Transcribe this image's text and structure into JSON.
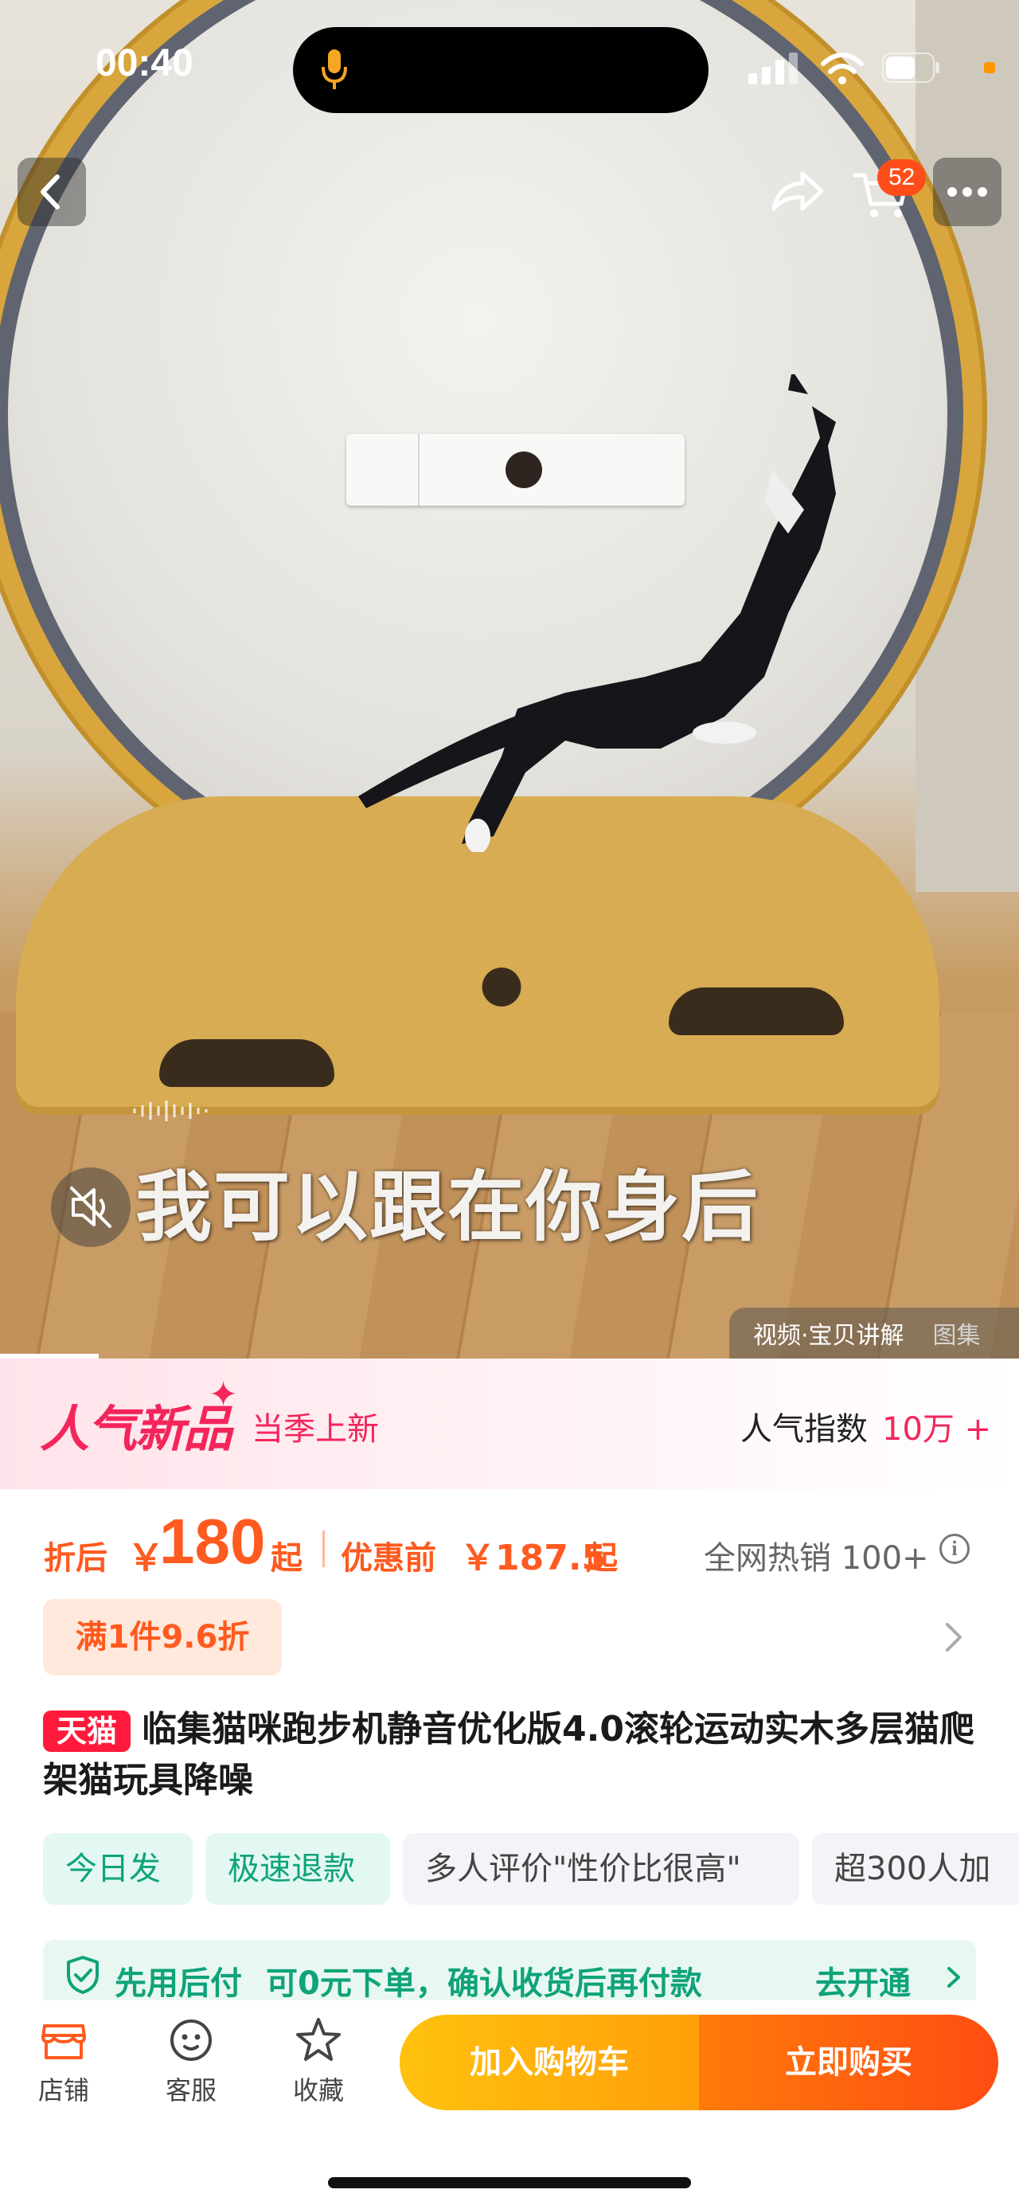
{
  "status_bar": {
    "time": "00:40"
  },
  "top_nav": {
    "cart_count": "52"
  },
  "video": {
    "subtitle": "我可以跟在你身后",
    "tabs": [
      "视频·宝贝讲解",
      "图集"
    ]
  },
  "banner": {
    "title": "人气新品",
    "subtitle": "当季上新",
    "popularity_label": "人气指数",
    "popularity_value": "10万 +"
  },
  "price": {
    "label": "折后",
    "currency": "￥",
    "value": "180",
    "suffix": "起",
    "before_label": "优惠前",
    "before_value": "￥187.5",
    "before_suffix": "起",
    "sales": "全网热销 100+",
    "discount_chip": "满1件9.6折"
  },
  "product": {
    "badge": "天猫",
    "title": "临集猫咪跑步机静音优化版4.0滚轮运动实木多层猫爬架猫玩具降噪"
  },
  "tags": [
    "今日发",
    "极速退款",
    "多人评价\"性价比很高\"",
    "超300人加"
  ],
  "pay_later": {
    "title": "先用后付",
    "desc": "可0元下单，确认收货后再付款",
    "action": "去开通"
  },
  "bottom_bar": {
    "store": "店铺",
    "service": "客服",
    "favorite": "收藏",
    "add_to_cart": "加入购物车",
    "buy_now": "立即购买"
  },
  "colors": {
    "accent": "#ff5a1f",
    "brand_pink": "#f4255b",
    "green": "#0fa37a"
  }
}
